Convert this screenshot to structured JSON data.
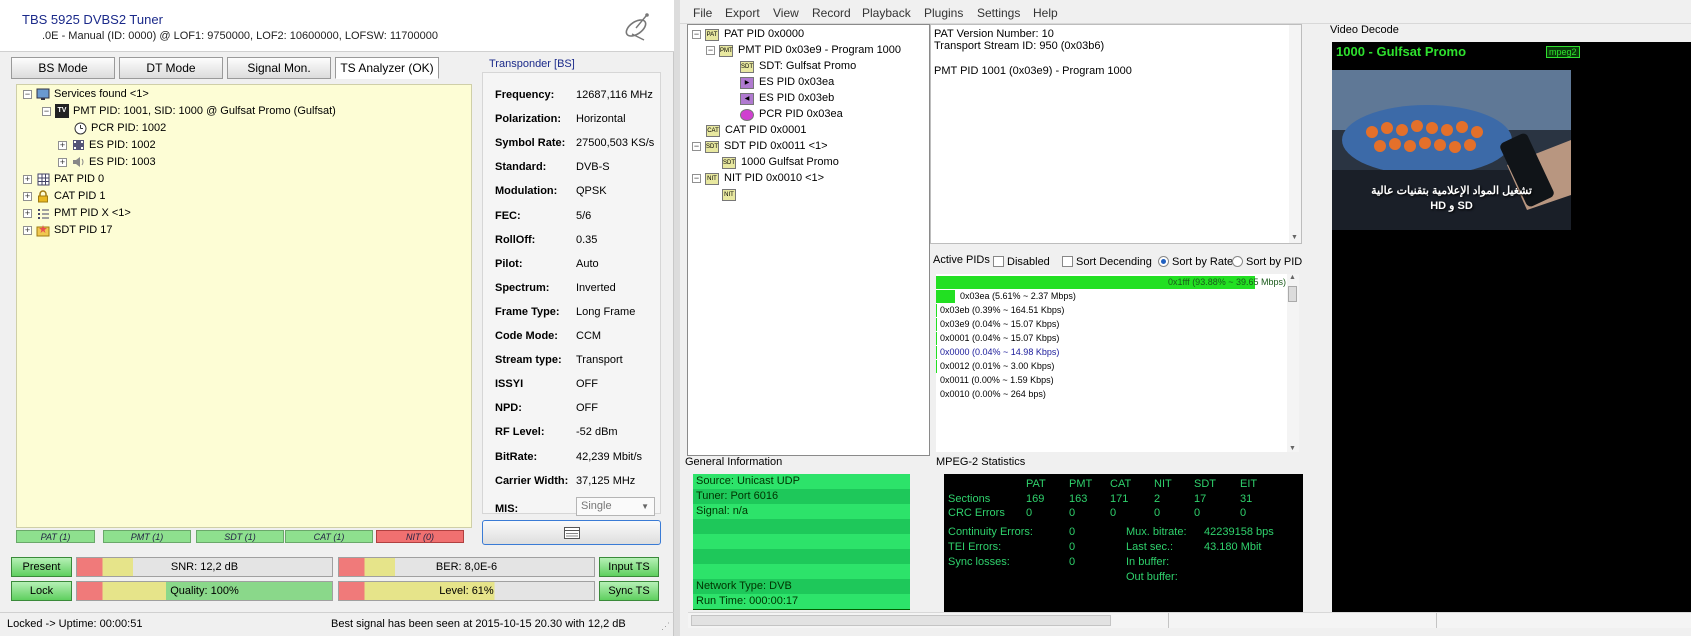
{
  "left_app": {
    "title": "TBS 5925 DVBS2 Tuner",
    "subtitle": ".0E - Manual (ID: 0000) @ LOF1: 9750000, LOF2: 10600000, LOFSW: 11700000",
    "tabs": [
      "BS Mode",
      "DT Mode",
      "Signal Mon.",
      "TS Analyzer (OK)"
    ],
    "active_tab": "TS Analyzer (OK)",
    "tree": {
      "services": "Services found <1>",
      "pmt_service": "PMT PID: 1001, SID: 1000 @ Gulfsat Promo (Gulfsat)",
      "pcr": "PCR PID: 1002",
      "es1": "ES PID: 1002",
      "es2": "ES PID: 1003",
      "pat": "PAT PID 0",
      "cat": "CAT PID 1",
      "pmtx": "PMT PID X <1>",
      "sdt": "SDT PID 17"
    },
    "pid_badges": [
      "PAT (1)",
      "PMT (1)",
      "SDT (1)",
      "CAT (1)",
      "NIT (0)"
    ],
    "transponder": {
      "title": "Transponder [BS]",
      "params": [
        {
          "k": "Frequency:",
          "v": "12687,116 MHz"
        },
        {
          "k": "Polarization:",
          "v": "Horizontal"
        },
        {
          "k": "Symbol Rate:",
          "v": "27500,503 KS/s"
        },
        {
          "k": "Standard:",
          "v": "DVB-S"
        },
        {
          "k": "Modulation:",
          "v": "QPSK"
        },
        {
          "k": "FEC:",
          "v": "5/6"
        },
        {
          "k": "RollOff:",
          "v": "0.35"
        },
        {
          "k": "Pilot:",
          "v": "Auto"
        },
        {
          "k": "Spectrum:",
          "v": "Inverted"
        },
        {
          "k": "Frame Type:",
          "v": "Long Frame"
        },
        {
          "k": "Code Mode:",
          "v": "CCM"
        },
        {
          "k": "Stream type:",
          "v": "Transport"
        },
        {
          "k": "ISSYI",
          "v": "OFF"
        },
        {
          "k": "NPD:",
          "v": "OFF"
        },
        {
          "k": "RF Level:",
          "v": "-52 dBm"
        },
        {
          "k": "BitRate:",
          "v": "42,239 Mbit/s"
        },
        {
          "k": "Carrier Width:",
          "v": "37,125 MHz"
        }
      ],
      "mis_label": "MIS:",
      "mis_value": "Single"
    },
    "buttons": {
      "present": "Present",
      "lock": "Lock",
      "input_ts": "Input TS",
      "sync_ts": "Sync TS"
    },
    "meters": {
      "snr": {
        "label": "SNR: 12,2 dB",
        "level": 0.22
      },
      "ber": {
        "label": "BER: 8,0E-6",
        "level": 0.22
      },
      "quality": {
        "label": "Quality: 100%",
        "level": 1.0
      },
      "level": {
        "label": "Level: 61%",
        "level": 0.61
      }
    },
    "status_left": "Locked -> Uptime: 00:00:51",
    "status_right": "Best signal has been seen at 2015-10-15 20.30 with 12,2 dB"
  },
  "right_app": {
    "menu": [
      "File",
      "Export",
      "View",
      "Record",
      "Playback",
      "Plugins",
      "Settings",
      "Help"
    ],
    "pid_tree": [
      "PAT PID 0x0000",
      "PMT PID 0x03e9 - Program 1000",
      "SDT: Gulfsat Promo",
      "ES PID 0x03ea",
      "ES PID 0x03eb",
      "PCR PID 0x03ea",
      "CAT PID 0x0001",
      "SDT PID 0x0011 <1>",
      "1000 Gulfsat Promo",
      "NIT PID 0x0010 <1>"
    ],
    "pat_info": {
      "line1": "PAT Version Number: 10",
      "line2": "Transport Stream ID: 950 (0x03b6)",
      "line3": "PMT PID 1001 (0x03e9) - Program 1000"
    },
    "active_pids": {
      "title": "Active PIDs",
      "options": {
        "disabled": "Disabled",
        "sort_desc": "Sort Decending",
        "sort_rate": "Sort by Rate",
        "sort_pid": "Sort by PID"
      },
      "rows": [
        {
          "text": "0x1fff (93.88% ~ 39.65 Mbps)",
          "share": 0.9388,
          "color": "#1a5a1a"
        },
        {
          "text": "0x03ea (5.61% ~ 2.37 Mbps)",
          "share": 0.0561,
          "color": "#000"
        },
        {
          "text": "0x03eb (0.39% ~ 164.51 Kbps)",
          "share": 0.0039,
          "color": "#000"
        },
        {
          "text": "0x03e9 (0.04% ~ 15.07 Kbps)",
          "share": 0.0004,
          "color": "#000"
        },
        {
          "text": "0x0001 (0.04% ~ 15.07 Kbps)",
          "share": 0.0004,
          "color": "#000"
        },
        {
          "text": "0x0000 (0.04% ~ 14.98 Kbps)",
          "share": 0.0004,
          "color": "#1a1a9a"
        },
        {
          "text": "0x0012 (0.01% ~ 3.00 Kbps)",
          "share": 0.0001,
          "color": "#000"
        },
        {
          "text": "0x0011 (0.00% ~ 1.59 Kbps)",
          "share": 0.0,
          "color": "#000"
        },
        {
          "text": "0x0010 (0.00% ~ 264 bps)",
          "share": 0.0,
          "color": "#000"
        }
      ]
    },
    "general": {
      "title": "General Information",
      "lines": [
        "Source: Unicast UDP",
        "Tuner: Port 6016",
        "Signal: n/a",
        "",
        "",
        "",
        "",
        "Network Type: DVB",
        "Run Time: 000:00:17"
      ]
    },
    "mpeg": {
      "title": "MPEG-2 Statistics",
      "headers": [
        "PAT",
        "PMT",
        "CAT",
        "NIT",
        "SDT",
        "EIT"
      ],
      "sections_label": "Sections",
      "sections": [
        "169",
        "163",
        "171",
        "2",
        "17",
        "31"
      ],
      "crc_label": "CRC Errors",
      "crc": [
        "0",
        "0",
        "0",
        "0",
        "0",
        "0"
      ],
      "continuity_label": "Continuity Errors:",
      "continuity": "0",
      "tei_label": "TEI Errors:",
      "tei": "0",
      "sync_label": "Sync losses:",
      "sync": "0",
      "mux_label": "Mux. bitrate:",
      "mux": "42239158 bps",
      "last_label": "Last sec.:",
      "last": "43.180 Mbit",
      "inbuf_label": "In buffer:",
      "outbuf_label": "Out buffer:"
    },
    "video": {
      "title": "Video Decode",
      "channel": "1000 - Gulfsat Promo",
      "codec": "mpeg2",
      "caption_ar": "تشغيل المواد الإعلامية بتقنيات عالية",
      "caption_2": "HD و SD"
    }
  }
}
